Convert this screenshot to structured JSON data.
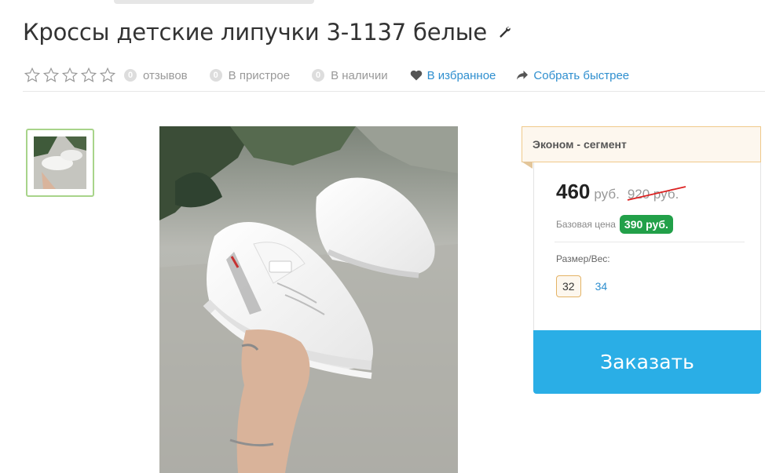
{
  "product": {
    "title": "Кроссы детские липучки 3-1137 белые"
  },
  "meta": {
    "reviews_count": "0",
    "reviews_label": "отзывов",
    "fitting_count": "0",
    "fitting_label": "В пристрое",
    "stock_count": "0",
    "stock_label": "В наличии",
    "favorite_label": "В избранное",
    "quick_label": "Собрать быстрее"
  },
  "rating": {
    "value": 0,
    "max": 5
  },
  "segment": {
    "label": "Эконом - сегмент"
  },
  "price": {
    "current": "460",
    "currency": "руб.",
    "old": "920 руб.",
    "base_label": "Базовая цена",
    "base_value": "390 руб."
  },
  "sizes": {
    "label": "Размер/Вес:",
    "options": [
      "32",
      "34"
    ],
    "selected": "32"
  },
  "actions": {
    "order_label": "Заказать"
  },
  "colors": {
    "accent": "#2aaee6",
    "link": "#2f8fcf",
    "badge_green": "#22a049",
    "segment_border": "#f0c98a"
  },
  "icons": [
    "wrench-icon",
    "star-icon",
    "heart-icon",
    "share-arrow-icon"
  ]
}
